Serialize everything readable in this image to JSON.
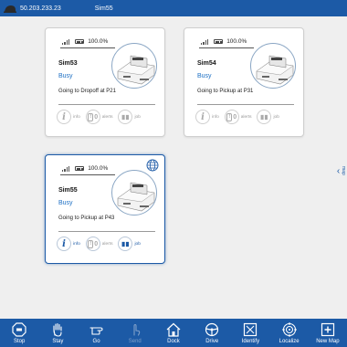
{
  "topbar": {
    "ip": "50.203.233.23",
    "host": "Sim55"
  },
  "cards": [
    {
      "battery": "100.0%",
      "name": "Sim53",
      "state": "Busy",
      "task": "Going to Dropoff at P21",
      "actions": {
        "info": "info",
        "alerts_count": "0",
        "alerts": "alerts",
        "job": "job"
      },
      "selected": false
    },
    {
      "battery": "100.0%",
      "name": "Sim54",
      "state": "Busy",
      "task": "Going to Pickup at P31",
      "actions": {
        "info": "info",
        "alerts_count": "0",
        "alerts": "alerts",
        "job": "job"
      },
      "selected": false
    },
    {
      "battery": "100.0%",
      "name": "Sim55",
      "state": "Busy",
      "task": "Going to Pickup at P43",
      "actions": {
        "info": "info",
        "alerts_count": "0",
        "alerts": "alerts",
        "job": "job"
      },
      "selected": true
    }
  ],
  "side_tab": {
    "label": "map"
  },
  "bottom_nav": [
    {
      "label": "Stop",
      "icon": "stop-icon",
      "enabled": true
    },
    {
      "label": "Stay",
      "icon": "hand-icon",
      "enabled": true
    },
    {
      "label": "Go",
      "icon": "pointing-hand-icon",
      "enabled": true
    },
    {
      "label": "Send",
      "icon": "tap-icon",
      "enabled": false
    },
    {
      "label": "Dock",
      "icon": "home-icon",
      "enabled": true
    },
    {
      "label": "Drive",
      "icon": "steering-wheel-icon",
      "enabled": true
    },
    {
      "label": "Identify",
      "icon": "identify-icon",
      "enabled": true
    },
    {
      "label": "Localize",
      "icon": "target-icon",
      "enabled": true
    },
    {
      "label": "New Map",
      "icon": "map-plus-icon",
      "enabled": true
    }
  ],
  "colors": {
    "primary": "#1c5aa6",
    "state_text": "#1c6fc4",
    "background": "#efefef"
  }
}
